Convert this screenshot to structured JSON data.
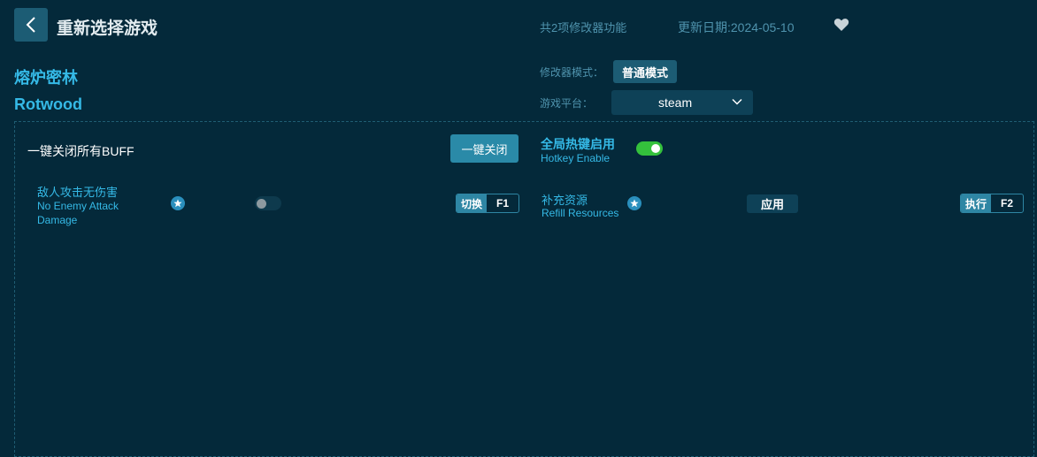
{
  "header": {
    "back_icon": "chevron-left-icon",
    "title": "重新选择游戏",
    "feature_count": "共2项修改器功能",
    "update_date": "更新日期:2024-05-10",
    "favorite_icon": "heart-icon"
  },
  "game": {
    "name_cn": "熔炉密林",
    "name_en": "Rotwood"
  },
  "settings": {
    "mode_label": "修改器模式：",
    "mode_value": "普通模式",
    "platform_label": "游戏平台：",
    "platform_value": "steam"
  },
  "toolbar": {
    "kill_all_label": "一键关闭所有BUFF",
    "kill_all_button": "一键关闭",
    "hotkey_cn": "全局热键启用",
    "hotkey_en": "Hotkey Enable",
    "hotkey_enabled": true
  },
  "options": [
    {
      "name_cn": "敌人攻击无伤害",
      "name_en_line1": "No Enemy Attack",
      "name_en_line2": "Damage",
      "type": "toggle",
      "enabled": false,
      "key_action": "切换",
      "key": "F1"
    },
    {
      "name_cn": "补充资源",
      "name_en_line1": "Refill Resources",
      "type": "button",
      "button_label": "应用",
      "key_action": "执行",
      "key": "F2"
    }
  ],
  "colors": {
    "background": "#04293a",
    "accent": "#35b9e6",
    "toggle_on": "#34c13c",
    "button": "#2a8aa8"
  }
}
